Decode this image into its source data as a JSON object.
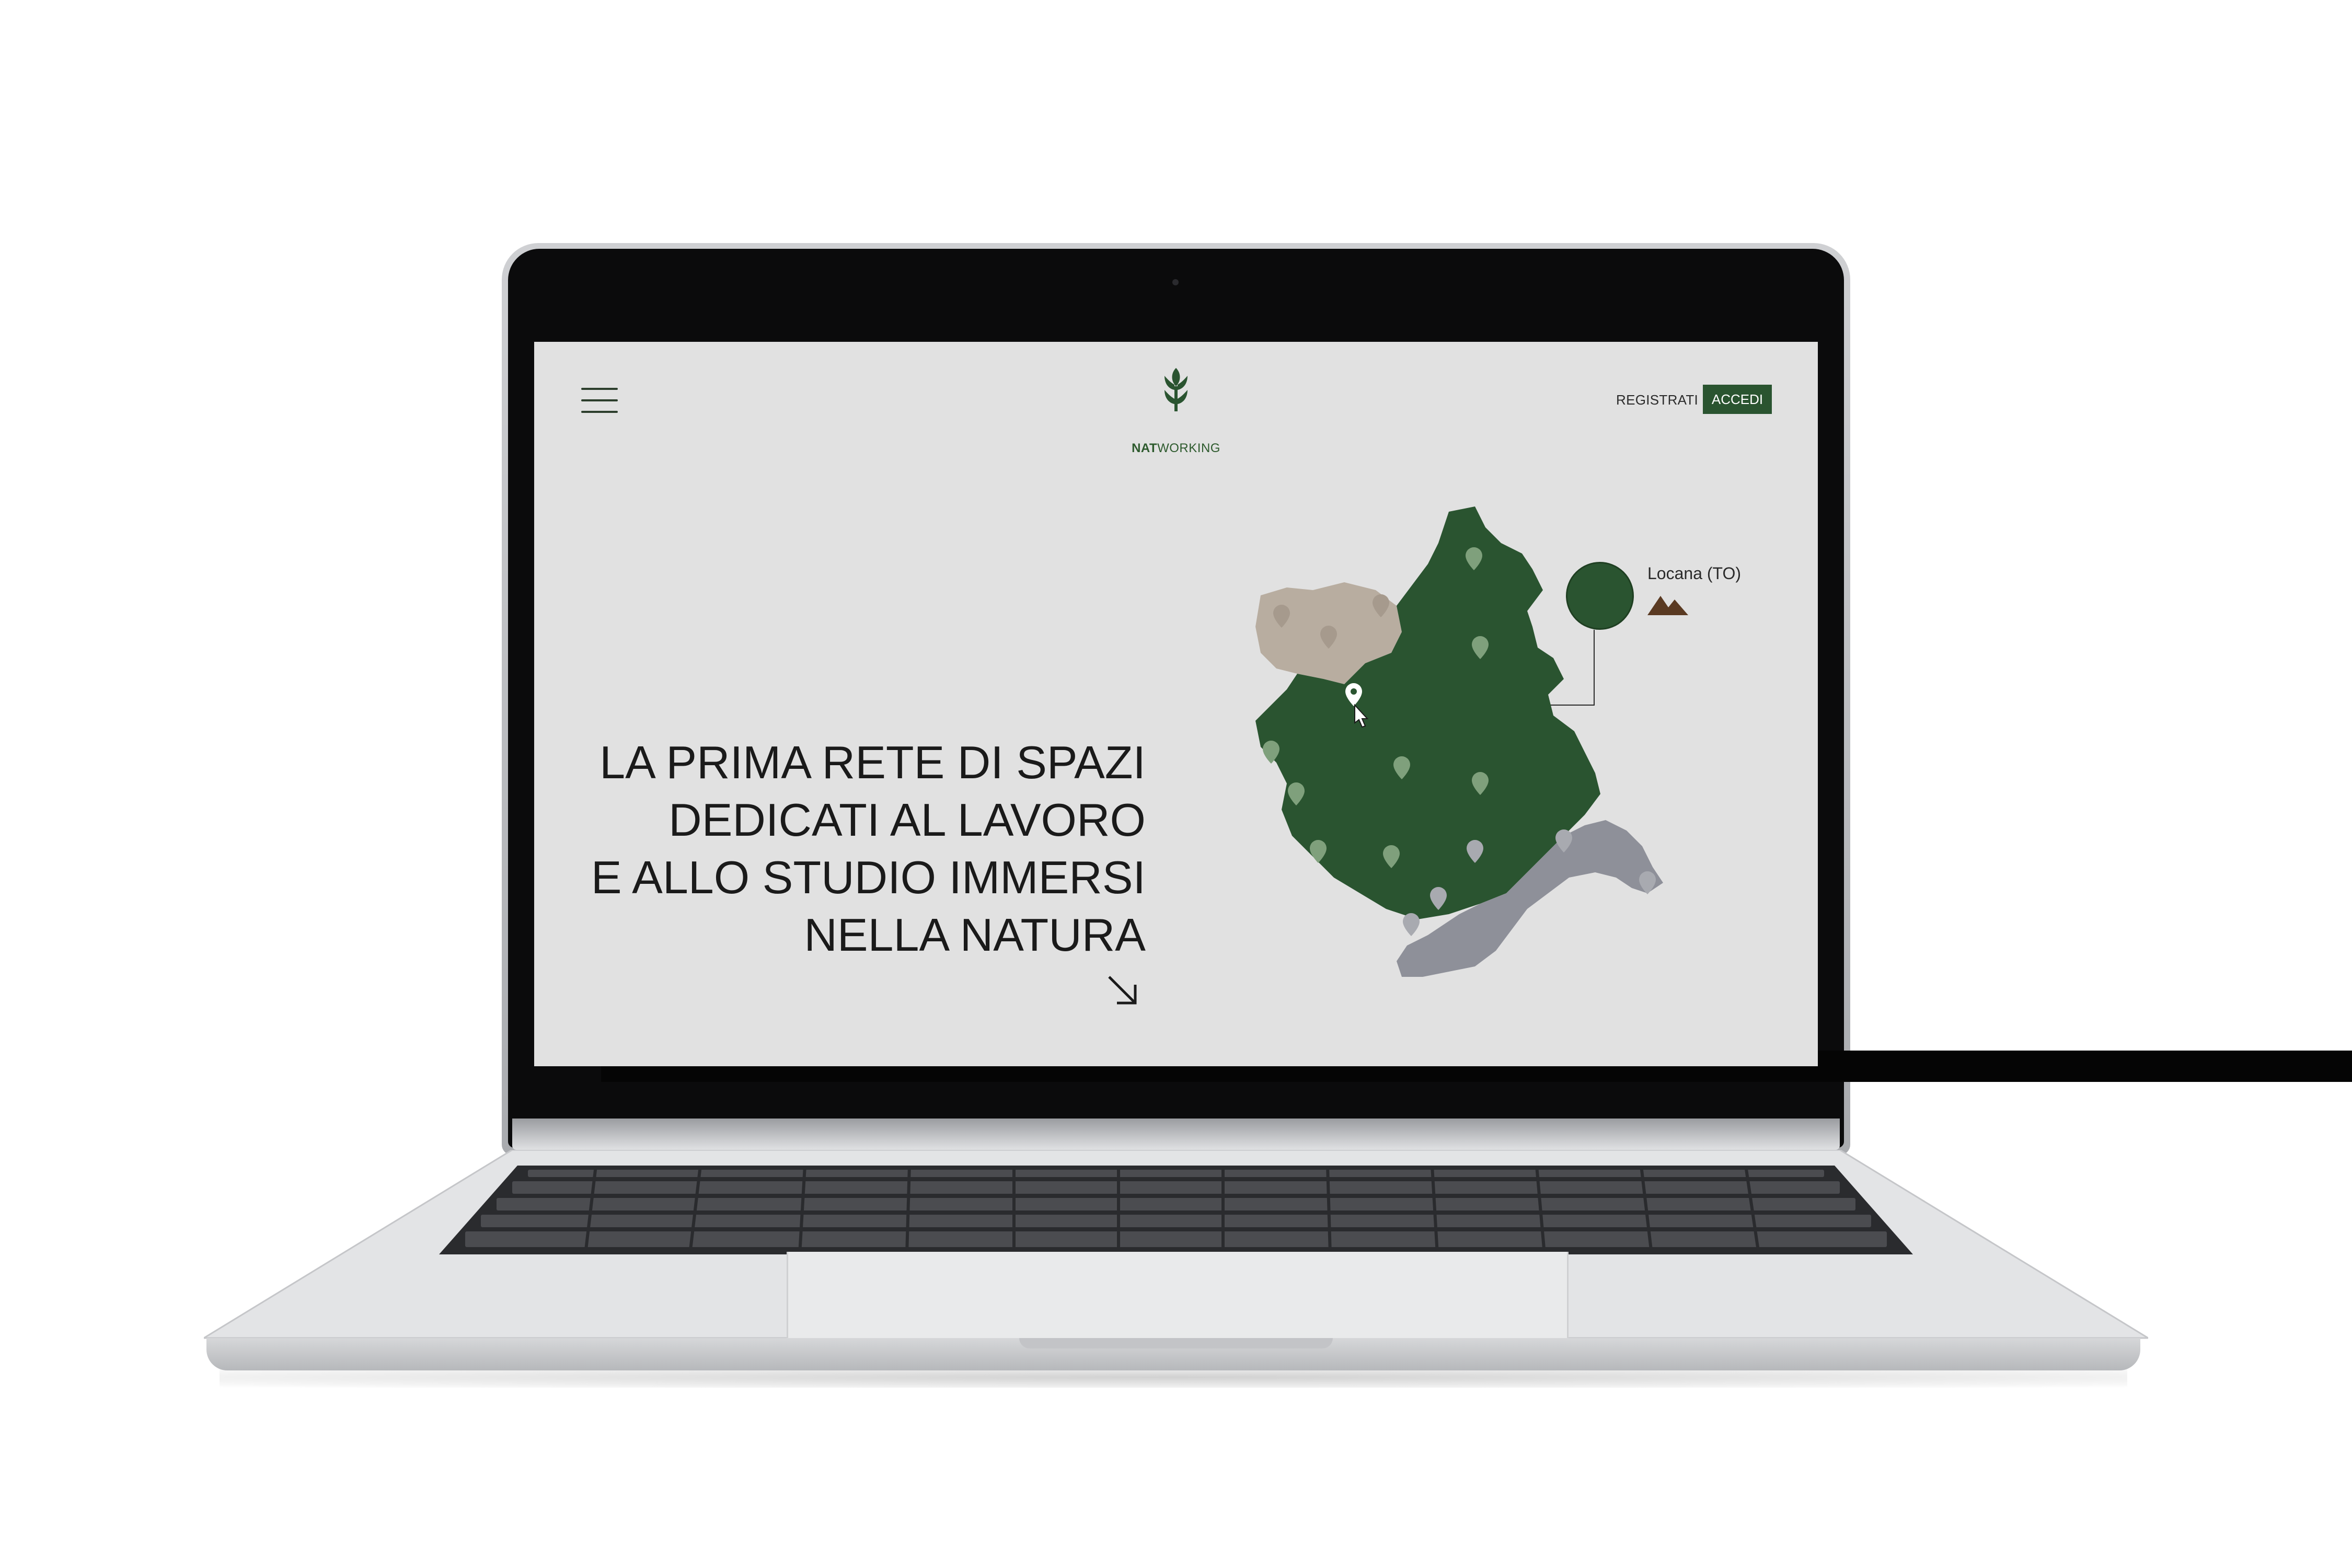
{
  "brand": {
    "logo_bold": "NAT",
    "logo_light": "WORKING"
  },
  "header": {
    "register_label": "REGISTRATI",
    "login_label": "ACCEDI"
  },
  "hero": {
    "lines": [
      "LA PRIMA RETE DI SPAZI",
      "DEDICATI AL LAVORO",
      "E ALLO STUDIO IMMERSI",
      "NELLA NATURA"
    ]
  },
  "map": {
    "tooltip_label": "Locana (TO)",
    "colors": {
      "piemonte": "#2a5430",
      "aosta": "#b8ada0",
      "liguria": "#8e9099",
      "pin_green": "#7fa07c",
      "pin_gray": "#a8aab0"
    }
  },
  "icons": [
    "menu-icon",
    "leaf-logo-icon",
    "arrow-down-right-icon",
    "pin-icon",
    "cursor-hand-icon",
    "mountains-icon"
  ]
}
